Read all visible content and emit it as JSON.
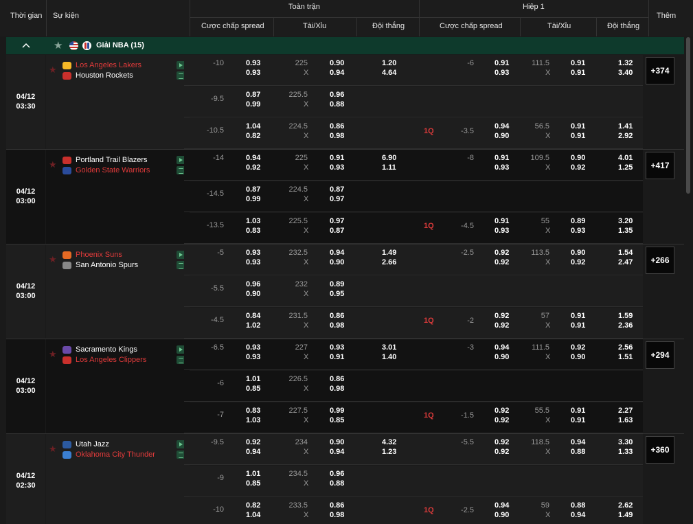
{
  "header": {
    "time": "Thời gian",
    "event": "Sự kiện",
    "full_match": "Toàn trận",
    "first_half": "Hiệp 1",
    "handicap": "Cược chấp spread",
    "over_under": "Tài/Xỉu",
    "winner": "Đội thắng",
    "handicap2": "Cược chấp spread",
    "over_under2": "Tài/Xỉu",
    "winner2": "Đội thắng",
    "more": "Thêm"
  },
  "league": {
    "title": "Giải NBA (15)"
  },
  "colors": {
    "home_red": "#e23b3b",
    "white": "#ffffff",
    "league_bg": "#0e3a2c"
  },
  "matches": [
    {
      "date": "04/12",
      "time": "03:30",
      "team1": "Los Angeles Lakers",
      "team2": "Houston Rockets",
      "team1_red": true,
      "team2_red": false,
      "more": "+374",
      "rows": [
        {
          "hc": "-10",
          "hc_o1": "0.93",
          "hc_o2": "0.93",
          "ou": "225",
          "ou_x": "X",
          "ou_o1": "0.90",
          "ou_o2": "0.94",
          "w1": "1.20",
          "w2": "4.64",
          "q": "",
          "h_hc": "-6",
          "h_o1": "0.91",
          "h_o2": "0.93",
          "h_ou": "111.5",
          "h_x": "X",
          "h_ou1": "0.91",
          "h_ou2": "0.91",
          "h_w1": "1.32",
          "h_w2": "3.40"
        },
        {
          "hc": "-9.5",
          "hc_o1": "0.87",
          "hc_o2": "0.99",
          "ou": "225.5",
          "ou_x": "X",
          "ou_o1": "0.96",
          "ou_o2": "0.88",
          "w1": "",
          "w2": "",
          "q": "",
          "h_hc": "",
          "h_o1": "",
          "h_o2": "",
          "h_ou": "",
          "h_x": "",
          "h_ou1": "",
          "h_ou2": "",
          "h_w1": "",
          "h_w2": ""
        },
        {
          "hc": "-10.5",
          "hc_o1": "1.04",
          "hc_o2": "0.82",
          "ou": "224.5",
          "ou_x": "X",
          "ou_o1": "0.86",
          "ou_o2": "0.98",
          "w1": "",
          "w2": "",
          "q": "1Q",
          "h_hc": "-3.5",
          "h_o1": "0.94",
          "h_o2": "0.90",
          "h_ou": "56.5",
          "h_x": "X",
          "h_ou1": "0.91",
          "h_ou2": "0.91",
          "h_w1": "1.41",
          "h_w2": "2.92"
        }
      ]
    },
    {
      "date": "04/12",
      "time": "03:00",
      "team1": "Portland Trail Blazers",
      "team2": "Golden State Warriors",
      "team1_red": false,
      "team2_red": true,
      "more": "+417",
      "rows": [
        {
          "hc": "-14",
          "hc_o1": "0.94",
          "hc_o2": "0.92",
          "ou": "225",
          "ou_x": "X",
          "ou_o1": "0.91",
          "ou_o2": "0.93",
          "w1": "6.90",
          "w2": "1.11",
          "q": "",
          "h_hc": "-8",
          "h_o1": "0.91",
          "h_o2": "0.93",
          "h_ou": "109.5",
          "h_x": "X",
          "h_ou1": "0.90",
          "h_ou2": "0.92",
          "h_w1": "4.01",
          "h_w2": "1.25"
        },
        {
          "hc": "-14.5",
          "hc_o1": "0.87",
          "hc_o2": "0.99",
          "ou": "224.5",
          "ou_x": "X",
          "ou_o1": "0.87",
          "ou_o2": "0.97",
          "w1": "",
          "w2": "",
          "q": "",
          "h_hc": "",
          "h_o1": "",
          "h_o2": "",
          "h_ou": "",
          "h_x": "",
          "h_ou1": "",
          "h_ou2": "",
          "h_w1": "",
          "h_w2": ""
        },
        {
          "hc": "-13.5",
          "hc_o1": "1.03",
          "hc_o2": "0.83",
          "ou": "225.5",
          "ou_x": "X",
          "ou_o1": "0.97",
          "ou_o2": "0.87",
          "w1": "",
          "w2": "",
          "q": "1Q",
          "h_hc": "-4.5",
          "h_o1": "0.91",
          "h_o2": "0.93",
          "h_ou": "55",
          "h_x": "X",
          "h_ou1": "0.89",
          "h_ou2": "0.93",
          "h_w1": "3.20",
          "h_w2": "1.35"
        }
      ]
    },
    {
      "date": "04/12",
      "time": "03:00",
      "team1": "Phoenix Suns",
      "team2": "San Antonio Spurs",
      "team1_red": true,
      "team2_red": false,
      "more": "+266",
      "rows": [
        {
          "hc": "-5",
          "hc_o1": "0.93",
          "hc_o2": "0.93",
          "ou": "232.5",
          "ou_x": "X",
          "ou_o1": "0.94",
          "ou_o2": "0.90",
          "w1": "1.49",
          "w2": "2.66",
          "q": "",
          "h_hc": "-2.5",
          "h_o1": "0.92",
          "h_o2": "0.92",
          "h_ou": "113.5",
          "h_x": "X",
          "h_ou1": "0.90",
          "h_ou2": "0.92",
          "h_w1": "1.54",
          "h_w2": "2.47"
        },
        {
          "hc": "-5.5",
          "hc_o1": "0.96",
          "hc_o2": "0.90",
          "ou": "232",
          "ou_x": "X",
          "ou_o1": "0.89",
          "ou_o2": "0.95",
          "w1": "",
          "w2": "",
          "q": "",
          "h_hc": "",
          "h_o1": "",
          "h_o2": "",
          "h_ou": "",
          "h_x": "",
          "h_ou1": "",
          "h_ou2": "",
          "h_w1": "",
          "h_w2": ""
        },
        {
          "hc": "-4.5",
          "hc_o1": "0.84",
          "hc_o2": "1.02",
          "ou": "231.5",
          "ou_x": "X",
          "ou_o1": "0.86",
          "ou_o2": "0.98",
          "w1": "",
          "w2": "",
          "q": "1Q",
          "h_hc": "-2",
          "h_o1": "0.92",
          "h_o2": "0.92",
          "h_ou": "57",
          "h_x": "X",
          "h_ou1": "0.91",
          "h_ou2": "0.91",
          "h_w1": "1.59",
          "h_w2": "2.36"
        }
      ]
    },
    {
      "date": "04/12",
      "time": "03:00",
      "team1": "Sacramento Kings",
      "team2": "Los Angeles Clippers",
      "team1_red": false,
      "team2_red": true,
      "more": "+294",
      "rows": [
        {
          "hc": "-6.5",
          "hc_o1": "0.93",
          "hc_o2": "0.93",
          "ou": "227",
          "ou_x": "X",
          "ou_o1": "0.93",
          "ou_o2": "0.91",
          "w1": "3.01",
          "w2": "1.40",
          "q": "",
          "h_hc": "-3",
          "h_o1": "0.94",
          "h_o2": "0.90",
          "h_ou": "111.5",
          "h_x": "X",
          "h_ou1": "0.92",
          "h_ou2": "0.90",
          "h_w1": "2.56",
          "h_w2": "1.51"
        },
        {
          "hc": "-6",
          "hc_o1": "1.01",
          "hc_o2": "0.85",
          "ou": "226.5",
          "ou_x": "X",
          "ou_o1": "0.86",
          "ou_o2": "0.98",
          "w1": "",
          "w2": "",
          "q": "",
          "h_hc": "",
          "h_o1": "",
          "h_o2": "",
          "h_ou": "",
          "h_x": "",
          "h_ou1": "",
          "h_ou2": "",
          "h_w1": "",
          "h_w2": ""
        },
        {
          "hc": "-7",
          "hc_o1": "0.83",
          "hc_o2": "1.03",
          "ou": "227.5",
          "ou_x": "X",
          "ou_o1": "0.99",
          "ou_o2": "0.85",
          "w1": "",
          "w2": "",
          "q": "1Q",
          "h_hc": "-1.5",
          "h_o1": "0.92",
          "h_o2": "0.92",
          "h_ou": "55.5",
          "h_x": "X",
          "h_ou1": "0.91",
          "h_ou2": "0.91",
          "h_w1": "2.27",
          "h_w2": "1.63"
        }
      ]
    },
    {
      "date": "04/12",
      "time": "02:30",
      "team1": "Utah Jazz",
      "team2": "Oklahoma City Thunder",
      "team1_red": false,
      "team2_red": true,
      "more": "+360",
      "rows": [
        {
          "hc": "-9.5",
          "hc_o1": "0.92",
          "hc_o2": "0.94",
          "ou": "234",
          "ou_x": "X",
          "ou_o1": "0.90",
          "ou_o2": "0.94",
          "w1": "4.32",
          "w2": "1.23",
          "q": "",
          "h_hc": "-5.5",
          "h_o1": "0.92",
          "h_o2": "0.92",
          "h_ou": "118.5",
          "h_x": "X",
          "h_ou1": "0.94",
          "h_ou2": "0.88",
          "h_w1": "3.30",
          "h_w2": "1.33"
        },
        {
          "hc": "-9",
          "hc_o1": "1.01",
          "hc_o2": "0.85",
          "ou": "234.5",
          "ou_x": "X",
          "ou_o1": "0.96",
          "ou_o2": "0.88",
          "w1": "",
          "w2": "",
          "q": "",
          "h_hc": "",
          "h_o1": "",
          "h_o2": "",
          "h_ou": "",
          "h_x": "",
          "h_ou1": "",
          "h_ou2": "",
          "h_w1": "",
          "h_w2": ""
        },
        {
          "hc": "-10",
          "hc_o1": "0.82",
          "hc_o2": "1.04",
          "ou": "233.5",
          "ou_x": "X",
          "ou_o1": "0.86",
          "ou_o2": "0.98",
          "w1": "",
          "w2": "",
          "q": "1Q",
          "h_hc": "-2.5",
          "h_o1": "0.94",
          "h_o2": "0.90",
          "h_ou": "59",
          "h_x": "X",
          "h_ou1": "0.88",
          "h_ou2": "0.94",
          "h_w1": "2.62",
          "h_w2": "1.49"
        }
      ]
    }
  ]
}
